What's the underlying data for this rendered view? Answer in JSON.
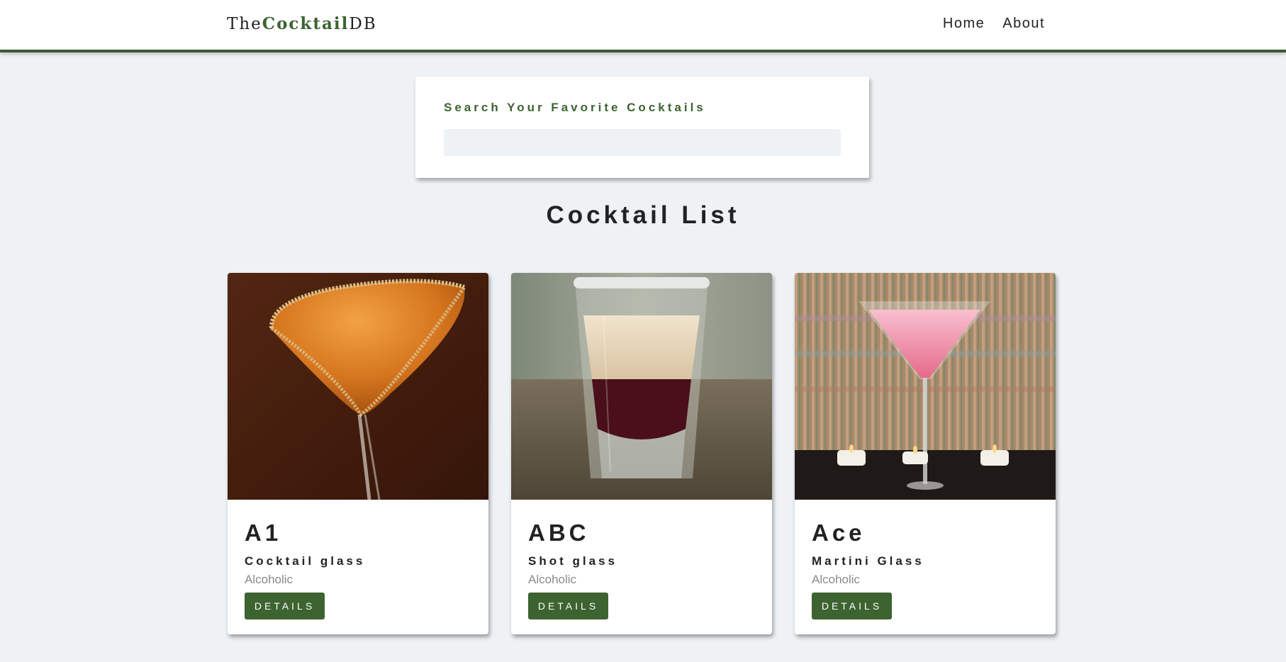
{
  "navbar": {
    "logo_prefix": "The",
    "logo_strong": "Cocktail",
    "logo_suffix": "DB",
    "links": [
      {
        "label": "Home"
      },
      {
        "label": "About"
      }
    ]
  },
  "search": {
    "label": "Search Your Favorite Cocktails",
    "value": ""
  },
  "section_title": "Cocktail List",
  "cocktails": [
    {
      "name": "A1",
      "glass": "Cocktail glass",
      "info": "Alcoholic",
      "button": "DETAILS",
      "image": "orange-martini-photo"
    },
    {
      "name": "ABC",
      "glass": "Shot glass",
      "info": "Alcoholic",
      "button": "DETAILS",
      "image": "layered-shot-photo"
    },
    {
      "name": "Ace",
      "glass": "Martini Glass",
      "info": "Alcoholic",
      "button": "DETAILS",
      "image": "pink-martini-photo"
    }
  ],
  "colors": {
    "brand": "#3c6330",
    "navbar_border": "#3c5a2f",
    "background": "#eef2f4",
    "text": "#222222",
    "muted": "#8a8a8a"
  }
}
